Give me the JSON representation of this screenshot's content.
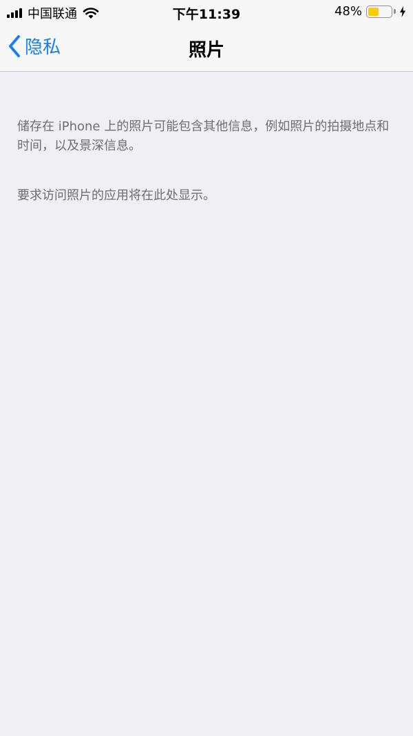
{
  "status_bar": {
    "carrier": "中国联通",
    "time": "下午11:39",
    "battery_percent": "48%",
    "battery_level": 0.48,
    "battery_color": "#ffcc00",
    "charging": true
  },
  "nav": {
    "back_label": "隐私",
    "title": "照片",
    "accent_color": "#157efb"
  },
  "content": {
    "description": "储存在 iPhone 上的照片可能包含其他信息，例如照片的拍摄地点和时间，以及景深信息。",
    "empty_message": "要求访问照片的应用将在此处显示。"
  }
}
